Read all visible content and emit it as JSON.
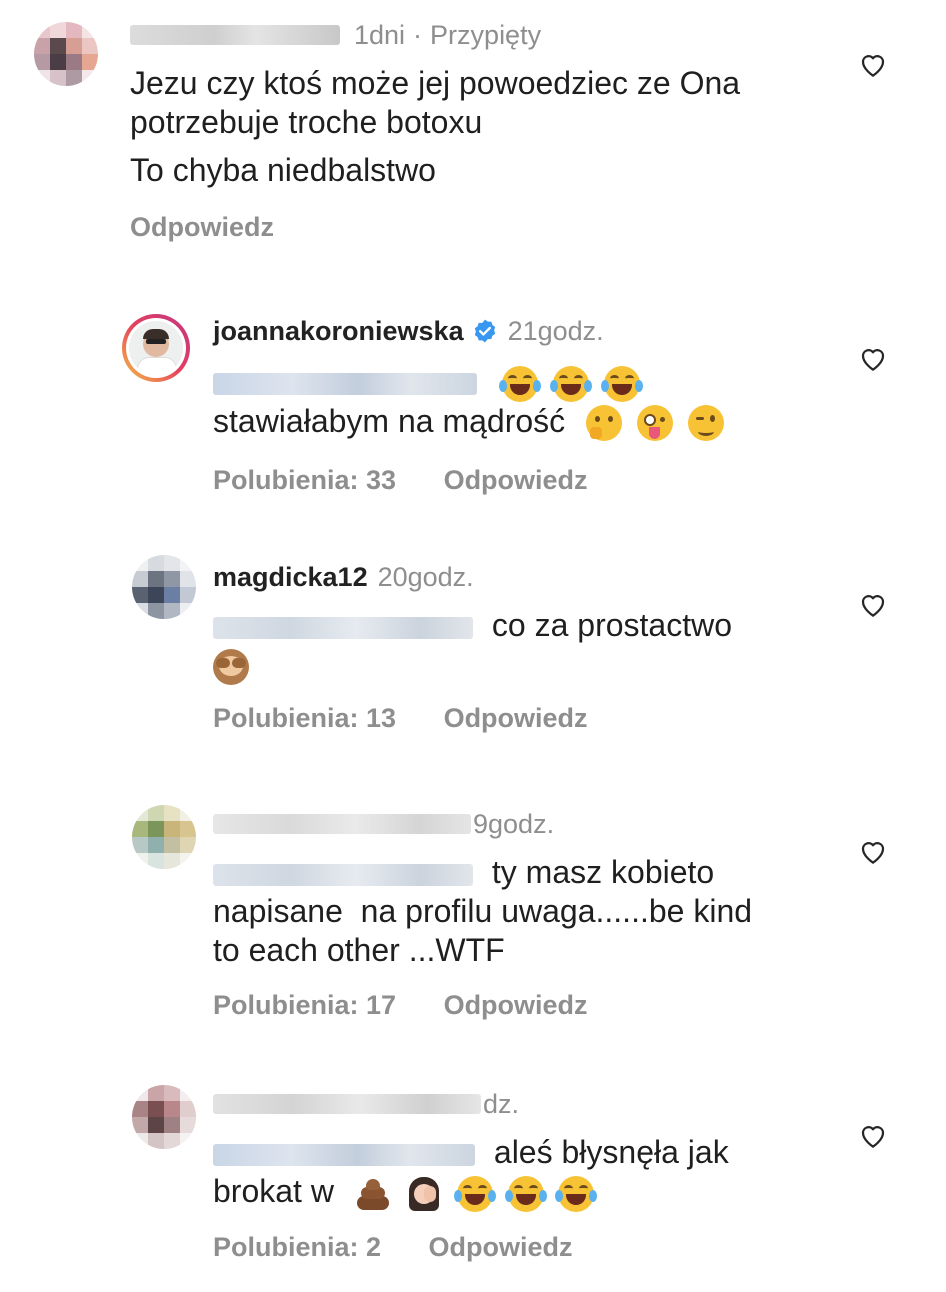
{
  "comments": [
    {
      "username": "",
      "time": "1dni",
      "pinned": "Przypięty",
      "lines": [
        "Jezu czy ktoś może jej powoedziec ze Ona",
        "potrzebuje troche botoxu",
        "To chyba niedbalstwo"
      ],
      "likes": "",
      "reply": "Odpowiedz"
    },
    {
      "username": "joannakoroniewska",
      "time": "21godz.",
      "verified": true,
      "line1_suffix": "",
      "line2": "stawiałabym na mądrość",
      "likes": "Polubienia: 33",
      "reply": "Odpowiedz"
    },
    {
      "username": "magdicka12",
      "time": "20godz.",
      "line1_suffix": "co za prostactwo",
      "likes": "Polubienia: 13",
      "reply": "Odpowiedz"
    },
    {
      "username": "",
      "time": "9godz.",
      "line1_suffix": "ty masz kobieto",
      "line2": "napisane  na profilu uwaga......be kind",
      "line3": "to each other ...WTF",
      "likes": "Polubienia: 17",
      "reply": "Odpowiedz"
    },
    {
      "username": "",
      "time": "dz.",
      "line1_suffix": "aleś błysnęła jak",
      "line2": "brokat w",
      "likes": "Polubienia: 2",
      "reply": "Odpowiedz"
    }
  ],
  "icons": {
    "heart": "heart-outline-icon",
    "verified": "verified-badge-icon",
    "emoji_laugh": "tears-of-joy-emoji",
    "emoji_think": "thinking-face-emoji",
    "emoji_zany": "zany-face-emoji",
    "emoji_wink": "winking-face-emoji",
    "emoji_monkey": "see-no-evil-monkey-emoji",
    "emoji_poo": "pile-of-poo-emoji",
    "emoji_facepalm": "facepalm-emoji"
  },
  "colors": {
    "text": "#1f1f1f",
    "muted": "#8e8e8e",
    "verified": "#3897f0"
  }
}
